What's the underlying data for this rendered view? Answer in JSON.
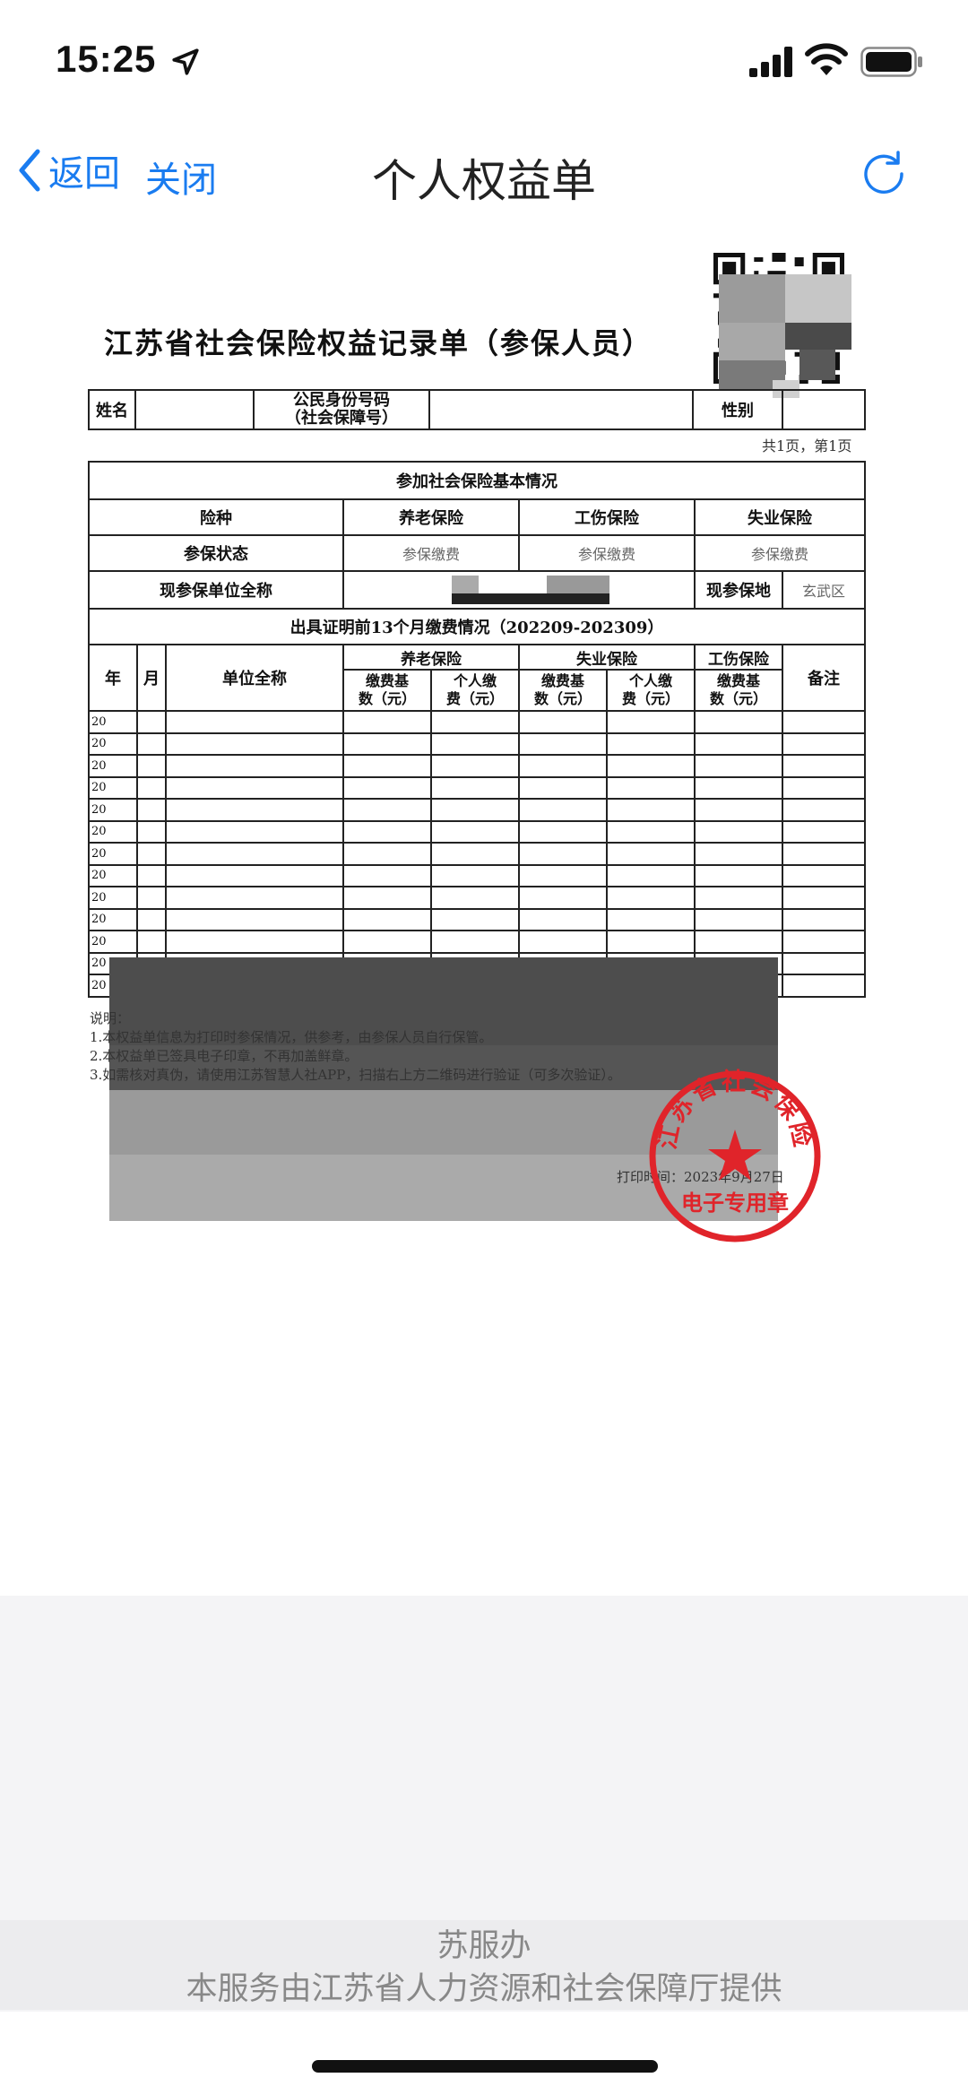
{
  "status_bar": {
    "time": "15:25"
  },
  "nav": {
    "back_label": "返回",
    "close_label": "关闭",
    "title": "个人权益单"
  },
  "document": {
    "title": "江苏省社会保险权益记录单（参保人员）",
    "page_info": "共1页，第1页",
    "header_row": {
      "name_label": "姓名",
      "id_label_line1": "公民身份号码",
      "id_label_line2": "（社会保障号）",
      "gender_label": "性别"
    },
    "basic_section_title": "参加社会保险基本情况",
    "insurance_type_label": "险种",
    "pension_label": "养老保险",
    "injury_label": "工伤保险",
    "unemployment_label": "失业保险",
    "status_label": "参保状态",
    "status_values": [
      "参保缴费",
      "参保缴费",
      "参保缴费"
    ],
    "unit_name_label": "现参保单位全称",
    "location_label": "现参保地",
    "location_value": "玄武区",
    "payment_section_title": "出具证明前13个月缴费情况（202209-202309）",
    "year_label": "年",
    "month_label": "月",
    "unit_full_label": "单位全称",
    "base_label_line1": "缴费基",
    "base_label_line2": "数（元）",
    "personal_label_line1": "个人缴",
    "personal_label_line2": "费（元）",
    "remarks_label": "备注",
    "row_prefix": "20"
  },
  "notes": [
    "说明：",
    "1.本权益单信息为打印时参保情况，供参考，由参保人员自行保管。",
    "2.本权益单已签具电子印章，不再加盖鲜章。",
    "3.如需核对真伪，请使用江苏智慧人社APP，扫描右上方二维码进行验证（可多次验证）。"
  ],
  "print_time": "打印时间：2023年9月27日",
  "seal": {
    "outer_text": "江苏省社会保险",
    "inner_text": "电子专用章",
    "color": "#e0242a"
  },
  "footer": {
    "provider": "苏服办",
    "text": "本服务由江苏省人力资源和社会保障厅提供"
  },
  "colors": {
    "accent": "#1a7cf0"
  }
}
